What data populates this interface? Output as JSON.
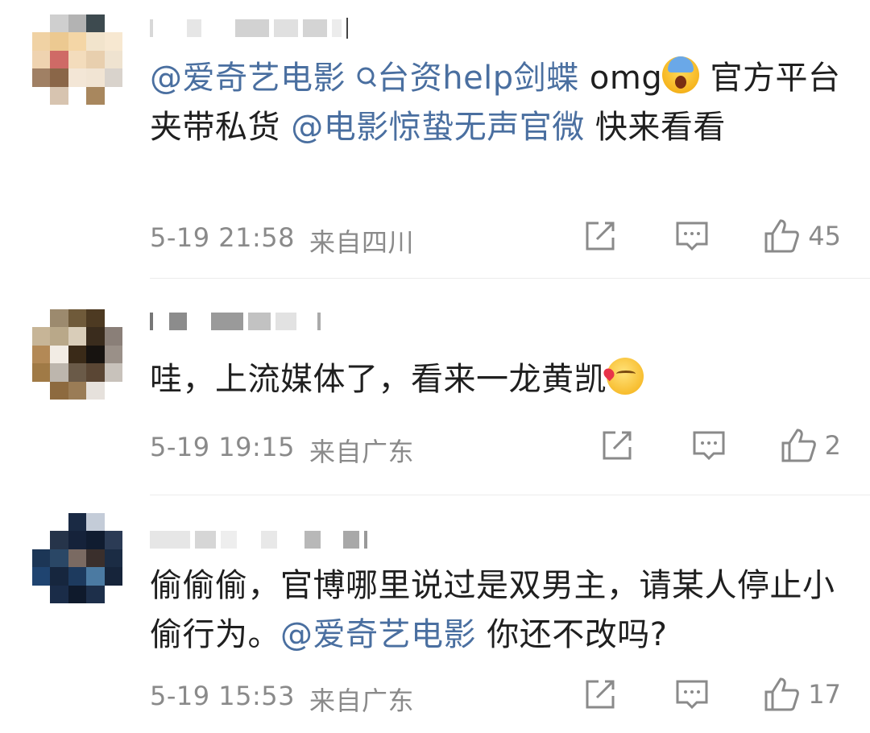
{
  "comments": [
    {
      "text": {
        "m1": "@爱奇艺电影",
        "link_icon": "search-icon",
        "link": "台资help剑蝶",
        "p1": " omg",
        "emoji": "face-screaming-emoji",
        "p2": " 官方平台夹带私货 ",
        "m2": "@电影惊蛰无声官微",
        "p3": " 快来看看"
      },
      "time": "5-19 21:58",
      "location": "来自四川",
      "likes": "45"
    },
    {
      "text": {
        "p1": "哇，上流媒体了，看来一龙黄凯",
        "emoji": "kissing-face-emoji"
      },
      "time": "5-19 19:15",
      "location": "来自广东",
      "likes": "2"
    },
    {
      "text": {
        "p1": "偷偷偷，官博哪里说过是双男主，请某人停止小偷行为。",
        "m1": "@爱奇艺电影",
        "p2": " 你还不改吗?"
      },
      "time": "5-19 15:53",
      "location": "来自广东",
      "likes": "17"
    }
  ],
  "icons": {
    "share": "share-icon",
    "comment": "comment-icon",
    "like": "thumbs-up-icon"
  },
  "colors": {
    "mention": "#4a6fa0",
    "meta": "#8a8a8a",
    "text": "#1f1f1f"
  }
}
